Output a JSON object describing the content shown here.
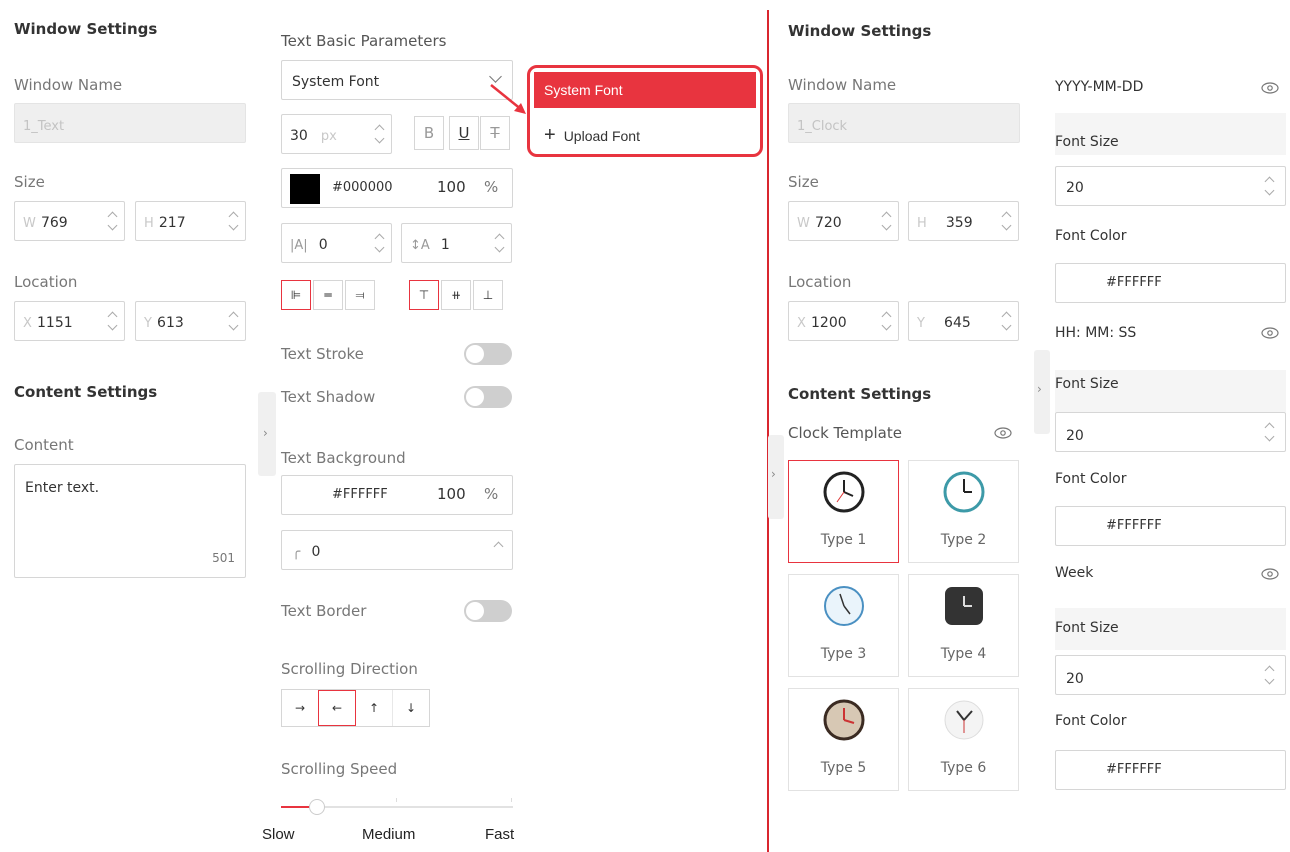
{
  "left_panel": {
    "window_settings_title": "Window Settings",
    "window_name_label": "Window Name",
    "window_name_value": "1_Text",
    "size_label": "Size",
    "width_prefix": "W",
    "width_value": "769",
    "height_prefix": "H",
    "height_value": "217",
    "location_label": "Location",
    "x_prefix": "X",
    "x_value": "1151",
    "y_prefix": "Y",
    "y_value": "613",
    "content_settings_title": "Content Settings",
    "content_label": "Content",
    "content_value": "Enter text.",
    "content_remaining": "501"
  },
  "text_params": {
    "title": "Text Basic Parameters",
    "font_select_value": "System Font",
    "font_size": "30",
    "font_size_unit": "px",
    "bold_label": "B",
    "underline_label": "U",
    "strike_label": "T",
    "color_hex": "#000000",
    "color_swatch": "#000000",
    "opacity": "100",
    "percent": "%",
    "letter_spacing": "0",
    "line_spacing": "1",
    "text_stroke_label": "Text Stroke",
    "text_shadow_label": "Text Shadow",
    "text_background_label": "Text Background",
    "bg_hex": "#FFFFFF",
    "bg_opacity": "100",
    "radius_value": "0",
    "text_border_label": "Text Border",
    "scrolling_direction_label": "Scrolling Direction",
    "scrolling_speed_label": "Scrolling Speed",
    "speed_slow": "Slow",
    "speed_medium": "Medium",
    "speed_fast": "Fast",
    "speed_level": 0.15
  },
  "font_dropdown": {
    "selected": "System Font",
    "upload": "Upload Font",
    "upload_icon": "+"
  },
  "right_panel": {
    "window_settings_title": "Window Settings",
    "window_name_label": "Window Name",
    "window_name_value": "1_Clock",
    "size_label": "Size",
    "width_prefix": "W",
    "width_value": "720",
    "height_prefix": "H",
    "height_value": "359",
    "location_label": "Location",
    "x_prefix": "X",
    "x_value": "1200",
    "y_prefix": "Y",
    "y_value": "645",
    "content_settings_title": "Content Settings",
    "clock_template_label": "Clock Template",
    "templates": [
      "Type 1",
      "Type 2",
      "Type 3",
      "Type 4",
      "Type 5",
      "Type 6"
    ]
  },
  "clock_format": {
    "date_label": "YYYY-MM-DD",
    "date_font_size_label": "Font Size",
    "date_font_size": "20",
    "date_font_color_label": "Font Color",
    "date_font_color": "#FFFFFF",
    "time_label": "HH: MM: SS",
    "time_font_size_label": "Font Size",
    "time_font_size": "20",
    "time_font_color_label": "Font Color",
    "time_font_color": "#FFFFFF",
    "week_label": "Week",
    "week_font_size_label": "Font Size",
    "week_font_size": "20",
    "week_font_color_label": "Font Color",
    "week_font_color": "#FFFFFF"
  },
  "colors": {
    "accent": "#e8343f",
    "divider": "#d9262f"
  }
}
